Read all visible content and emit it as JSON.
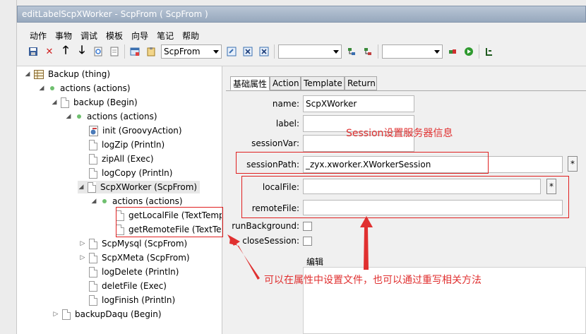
{
  "window": {
    "title": "editLabelScpXWorker - ScpFrom ( ScpFrom )"
  },
  "menu": [
    "动作",
    "事物",
    "调试",
    "模板",
    "向导",
    "笔记",
    "帮助"
  ],
  "toolbar": {
    "combo1_value": "ScpFrom",
    "combo2_value": "",
    "combo3_value": ""
  },
  "tree": {
    "nodes": [
      {
        "label": "Backup (thing)"
      },
      {
        "label": "actions (actions)"
      },
      {
        "label": "backup (Begin)"
      },
      {
        "label": "actions (actions)"
      },
      {
        "label": "init (GroovyAction)"
      },
      {
        "label": "logZip (Println)"
      },
      {
        "label": "zipAll (Exec)"
      },
      {
        "label": "logCopy (Println)"
      },
      {
        "label": "ScpXWorker (ScpFrom)"
      },
      {
        "label": "actions (actions)"
      },
      {
        "label": "getLocalFile (TextTemp"
      },
      {
        "label": "getRemoteFile (TextTe"
      },
      {
        "label": "ScpMysql (ScpFrom)"
      },
      {
        "label": "ScpXMeta (ScpFrom)"
      },
      {
        "label": "logDelete (Println)"
      },
      {
        "label": "deletFile (Exec)"
      },
      {
        "label": "logFinish (Println)"
      },
      {
        "label": "backupDaqu (Begin)"
      }
    ]
  },
  "tabs": [
    "基础属性",
    "Action",
    "Template",
    "Return"
  ],
  "form": {
    "name_label": "name:",
    "name_value": "ScpXWorker",
    "label_label": "label:",
    "label_value": "",
    "sessionvar_label": "sessionVar:",
    "sessionvar_value": "",
    "sessionpath_label": "sessionPath:",
    "sessionpath_value": "_zyx.xworker.XWorkerSession",
    "localfile_label": "localFile:",
    "localfile_value": "",
    "remotefile_label": "remoteFile:",
    "remotefile_value": "",
    "runbackground_label": "runBackground:",
    "closesession_label": "closeSession:",
    "star_label": "*",
    "edit_label": "编辑"
  },
  "annotations": {
    "session_note": "Session设置服务器信息",
    "file_note": "可以在属性中设置文件，也可以通过重写相关方法",
    "color": "#e03030"
  }
}
